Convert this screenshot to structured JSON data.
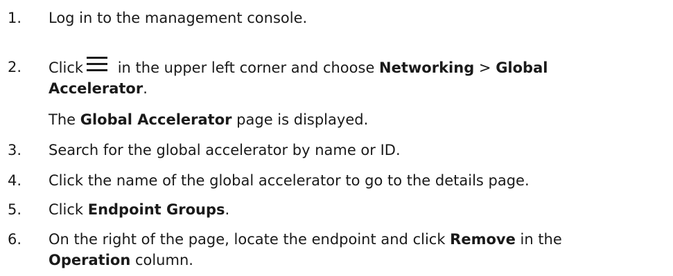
{
  "steps": [
    {
      "number": "1.",
      "text": "Log in to the management console."
    },
    {
      "number": "2.",
      "prefix": "Click",
      "icon": "menu-icon",
      "middle": " in the upper left corner and choose ",
      "menu_1": "Networking",
      "separator": " > ",
      "menu_2_line_1": "Global",
      "menu_2_line_2": "Accelerator",
      "end": ".",
      "result_page": "Global Accelerator",
      "result_suffix": " page is displayed.",
      "result_prefix": "The "
    },
    {
      "number": "3.",
      "text": "Search for the global accelerator by name or ID."
    },
    {
      "number": "4.",
      "text": "Click the name of the global accelerator to go to the details page."
    },
    {
      "number": "5.",
      "prefix": "Click ",
      "bold": "Endpoint Groups",
      "end": "."
    },
    {
      "number": "6.",
      "prefix": "On the right of the page, locate the endpoint and click ",
      "bold_1": "Remove",
      "middle": " in the",
      "bold_2": "Operation",
      "end": " column."
    }
  ]
}
